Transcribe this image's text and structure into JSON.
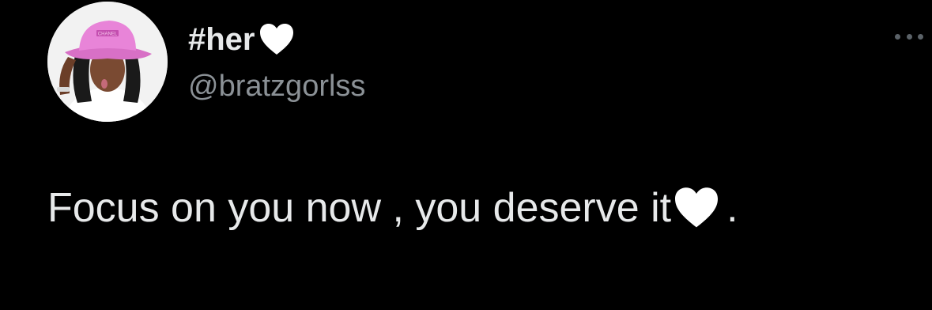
{
  "author": {
    "display_name": "#her",
    "display_name_emoji": "white-heart-icon",
    "handle": "@bratzgorlss",
    "avatar_hat_text": "CHANEL"
  },
  "menu": {
    "icon": "more-options-icon"
  },
  "tweet": {
    "text": "Focus on you now , you deserve it",
    "text_emoji": "white-heart-icon",
    "text_suffix": "."
  },
  "colors": {
    "background": "#000000",
    "primary_text": "#e7e9ea",
    "secondary_text": "#8b9196",
    "heart": "#ffffff",
    "hat": "#e884d8"
  }
}
